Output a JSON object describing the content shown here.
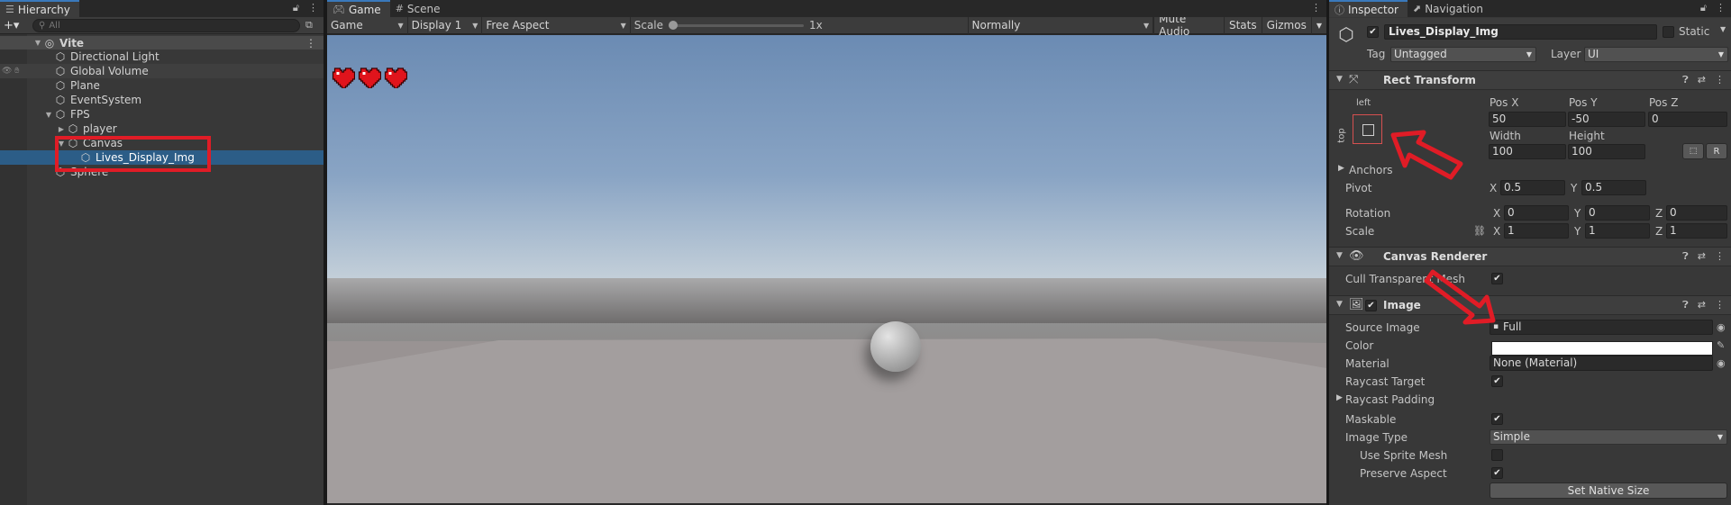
{
  "hierarchy": {
    "tab_label": "Hierarchy",
    "add_button": "+▾",
    "search_placeholder": "All",
    "items": [
      {
        "label": "Vite"
      },
      {
        "label": "Directional Light"
      },
      {
        "label": "Global Volume"
      },
      {
        "label": "Plane"
      },
      {
        "label": "EventSystem"
      },
      {
        "label": "FPS"
      },
      {
        "label": "player"
      },
      {
        "label": "Canvas"
      },
      {
        "label": "Lives_Display_Img"
      },
      {
        "label": "Sphere"
      }
    ]
  },
  "game": {
    "tabs": [
      {
        "label": "Game"
      },
      {
        "label": "Scene"
      }
    ],
    "toolbar": {
      "mode": "Game",
      "display": "Display 1",
      "aspect": "Free Aspect",
      "scale_label": "Scale",
      "scale_value": "1x",
      "play_focus": "Normally",
      "mute_audio": "Mute Audio",
      "stats": "Stats",
      "gizmos": "Gizmos"
    },
    "hearts_count": 3
  },
  "inspector": {
    "tabs": [
      {
        "label": "Inspector"
      },
      {
        "label": "Navigation"
      }
    ],
    "object_name": "Lives_Display_Img",
    "static_label": "Static",
    "tag_label": "Tag",
    "tag_value": "Untagged",
    "layer_label": "Layer",
    "layer_value": "UI",
    "rect_transform": {
      "title": "Rect Transform",
      "anchor_h": "left",
      "anchor_v": "top",
      "pos_x_label": "Pos X",
      "pos_x": "50",
      "pos_y_label": "Pos Y",
      "pos_y": "-50",
      "pos_z_label": "Pos Z",
      "pos_z": "0",
      "width_label": "Width",
      "width": "100",
      "height_label": "Height",
      "height": "100",
      "r_button": "R",
      "anchors_label": "Anchors",
      "pivot_label": "Pivot",
      "pivot_x": "0.5",
      "pivot_y": "0.5",
      "rotation_label": "Rotation",
      "rot_x": "0",
      "rot_y": "0",
      "rot_z": "0",
      "scale_label": "Scale",
      "scale_x": "1",
      "scale_y": "1",
      "scale_z": "1",
      "x": "X",
      "y": "Y",
      "z": "Z"
    },
    "canvas_renderer": {
      "title": "Canvas Renderer",
      "cull_label": "Cull Transparent Mesh"
    },
    "image": {
      "title": "Image",
      "source_image_label": "Source Image",
      "source_image": "Full",
      "color_label": "Color",
      "color": "#ffffff",
      "material_label": "Material",
      "material": "None (Material)",
      "raycast_target_label": "Raycast Target",
      "raycast_padding_label": "Raycast Padding",
      "maskable_label": "Maskable",
      "image_type_label": "Image Type",
      "image_type": "Simple",
      "use_sprite_mesh_label": "Use Sprite Mesh",
      "preserve_aspect_label": "Preserve Aspect",
      "set_native_size": "Set Native Size"
    }
  },
  "colors": {
    "selection": "#2c5d87",
    "annotation_red": "#e01c26",
    "heart": "#e0141c"
  }
}
